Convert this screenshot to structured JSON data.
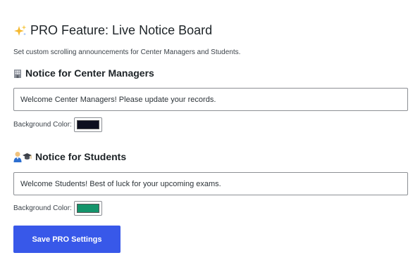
{
  "header": {
    "title": "PRO Feature: Live Notice Board",
    "title_icon": "sparkles-icon",
    "subtitle": "Set custom scrolling announcements for Center Managers and Students."
  },
  "managers": {
    "heading": "Notice for Center Managers",
    "icon": "office-building-icon",
    "notice_value": "Welcome Center Managers! Please update your records.",
    "bg_label": "Background Color:",
    "bg_color": "#0d0f1f"
  },
  "students": {
    "heading": "Notice for Students",
    "icon": "student-icon",
    "notice_value": "Welcome Students! Best of luck for your upcoming exams.",
    "bg_label": "Background Color:",
    "bg_color": "#14946b"
  },
  "actions": {
    "save_label": "Save PRO Settings"
  },
  "colors": {
    "accent": "#3858e9"
  }
}
